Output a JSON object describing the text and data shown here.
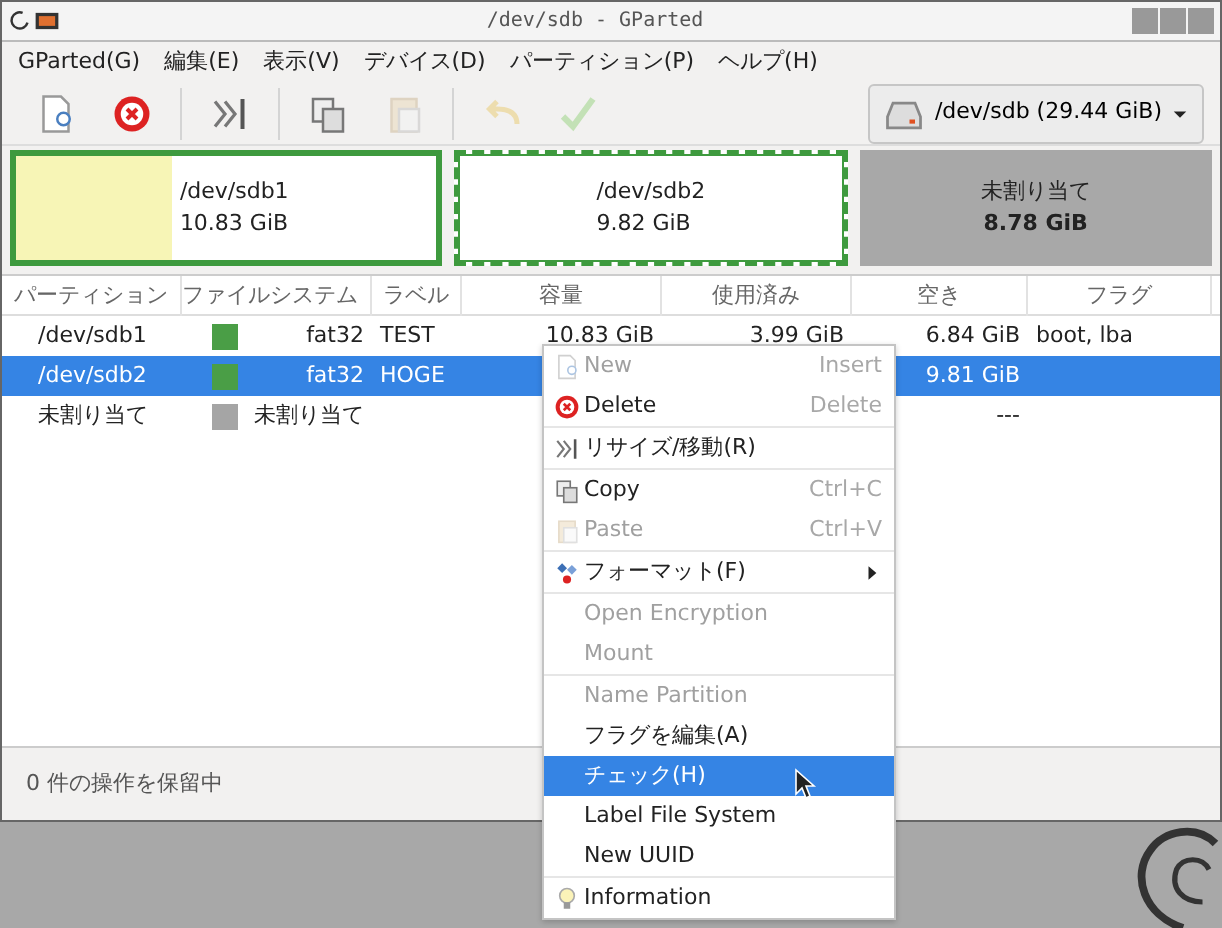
{
  "window": {
    "title": "/dev/sdb - GParted"
  },
  "menubar": [
    "GParted(G)",
    "編集(E)",
    "表示(V)",
    "デバイス(D)",
    "パーティション(P)",
    "ヘルプ(H)"
  ],
  "toolbar": [
    {
      "kind": "new",
      "disabled": false
    },
    {
      "kind": "delete",
      "disabled": false
    },
    {
      "kind": "resize",
      "disabled": false
    },
    {
      "kind": "copy",
      "disabled": false
    },
    {
      "kind": "paste",
      "disabled": true
    },
    {
      "kind": "undo",
      "disabled": true
    },
    {
      "kind": "apply",
      "disabled": true
    }
  ],
  "device": {
    "label": "/dev/sdb (29.44 GiB)"
  },
  "partition_map": [
    {
      "kind": "partition",
      "name": "/dev/sdb1",
      "size": "10.83 GiB",
      "selected": false,
      "level": 0.37
    },
    {
      "kind": "partition",
      "name": "/dev/sdb2",
      "size": "9.82 GiB",
      "selected": true
    },
    {
      "kind": "unallocated",
      "name": "未割り当て",
      "size": "8.78 GiB",
      "selected": false
    }
  ],
  "table": {
    "columns": [
      "パーティション",
      "ファイルシステム",
      "ラベル",
      "容量",
      "使用済み",
      "空き",
      "フラグ"
    ],
    "rows": [
      {
        "partition": "/dev/sdb1",
        "color": "#4a9e46",
        "filesystem": "fat32",
        "label": "TEST",
        "size": "10.83 GiB",
        "used": "3.99 GiB",
        "free": "6.84 GiB",
        "flags": "boot, lba",
        "selected": false
      },
      {
        "partition": "/dev/sdb2",
        "color": "#4a9e46",
        "filesystem": "fat32",
        "label": "HOGE",
        "free": "9.81 GiB",
        "selected": true
      },
      {
        "partition": "未割り当て",
        "color": "#a5a5a5",
        "filesystem": "未割り当て",
        "free": "---",
        "selected": false
      }
    ]
  },
  "status_bar": "0 件の操作を保留中",
  "context_menu": [
    [
      {
        "label": "New",
        "shortcut": "Insert",
        "kind": "new",
        "disabled": true,
        "selected": false
      },
      {
        "label": "Delete",
        "shortcut": "Delete",
        "kind": "delete",
        "disabled": false,
        "selected": false
      }
    ],
    [
      {
        "label": "リサイズ/移動(R)",
        "kind": "resize",
        "disabled": false,
        "selected": false
      }
    ],
    [
      {
        "label": "Copy",
        "shortcut": "Ctrl+C",
        "kind": "copy",
        "disabled": false,
        "selected": false
      },
      {
        "label": "Paste",
        "shortcut": "Ctrl+V",
        "kind": "paste",
        "disabled": true,
        "selected": false
      }
    ],
    [
      {
        "label": "フォーマット(F)",
        "kind": "format",
        "submenu": true,
        "disabled": false,
        "selected": false
      }
    ],
    [
      {
        "label": "Open Encryption",
        "disabled": true,
        "selected": false
      },
      {
        "label": "Mount",
        "disabled": true,
        "selected": false
      }
    ],
    [
      {
        "label": "Name Partition",
        "disabled": true,
        "selected": false
      },
      {
        "label": "フラグを編集(A)",
        "disabled": false,
        "selected": false
      },
      {
        "label": "チェック(H)",
        "disabled": false,
        "selected": true
      },
      {
        "label": "Label File System",
        "disabled": false,
        "selected": false
      },
      {
        "label": "New UUID",
        "disabled": false,
        "selected": false
      }
    ],
    [
      {
        "label": "Information",
        "kind": "info",
        "disabled": false,
        "selected": false
      }
    ]
  ]
}
